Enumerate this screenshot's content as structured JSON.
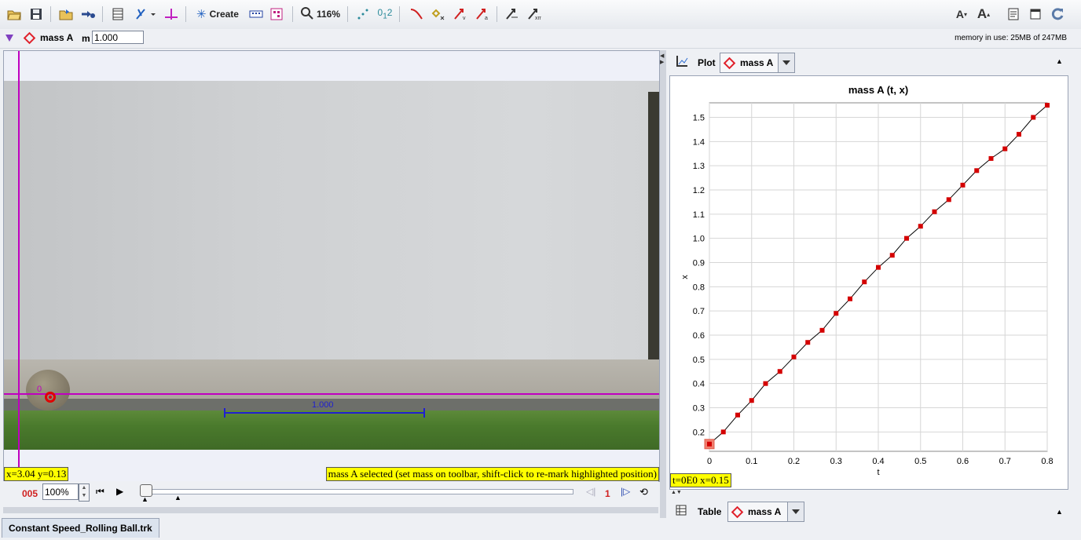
{
  "toolbar": {
    "create_label": "Create",
    "zoom_label": "116%",
    "font_smaller": "A",
    "font_larger": "A"
  },
  "trackbar": {
    "track_name": "mass A",
    "mass_label": "m",
    "mass_value": "1.000",
    "memory": "memory in use: 25MB of 247MB"
  },
  "video": {
    "axis_label": "0",
    "tape_label": "1.000",
    "coord_readout": "x=3.04  y=0.13",
    "status_message": "mass A selected (set mass on toolbar, shift-click to re-mark highlighted position)"
  },
  "player": {
    "frame_number": "005",
    "rate": "100%",
    "step_size": "1",
    "slider_position": 0.0
  },
  "plot_view": {
    "tab_label": "Plot",
    "track_select": "mass A",
    "readout": "t=0E0  x=0.15"
  },
  "table_view": {
    "tab_label": "Table",
    "track_select": "mass A"
  },
  "file_tab": "Constant Speed_Rolling Ball.trk",
  "chart_data": {
    "type": "scatter",
    "title": "mass A (t, x)",
    "xlabel": "t",
    "ylabel": "x",
    "xlim": [
      0,
      0.8
    ],
    "ylim": [
      0.12,
      1.56
    ],
    "xticks": [
      "0",
      "0.1",
      "0.2",
      "0.3",
      "0.4",
      "0.5",
      "0.6",
      "0.7",
      "0.8"
    ],
    "yticks": [
      "0.2",
      "0.3",
      "0.4",
      "0.5",
      "0.6",
      "0.7",
      "0.8",
      "0.9",
      "1.0",
      "1.1",
      "1.2",
      "1.3",
      "1.4",
      "1.5"
    ],
    "grid": true,
    "connected": true,
    "point_color": "#d40000",
    "line_color": "#000000",
    "highlight_index": 0,
    "series": [
      {
        "x": [
          0.0,
          0.033,
          0.067,
          0.1,
          0.133,
          0.167,
          0.2,
          0.233,
          0.267,
          0.3,
          0.333,
          0.367,
          0.4,
          0.433,
          0.467,
          0.5,
          0.533,
          0.567,
          0.6,
          0.633,
          0.667,
          0.7,
          0.733,
          0.767,
          0.8
        ],
        "y": [
          0.15,
          0.2,
          0.27,
          0.33,
          0.4,
          0.45,
          0.51,
          0.57,
          0.62,
          0.69,
          0.75,
          0.82,
          0.88,
          0.93,
          1.0,
          1.05,
          1.11,
          1.16,
          1.22,
          1.28,
          1.33,
          1.37,
          1.43,
          1.5,
          1.55
        ]
      }
    ]
  }
}
